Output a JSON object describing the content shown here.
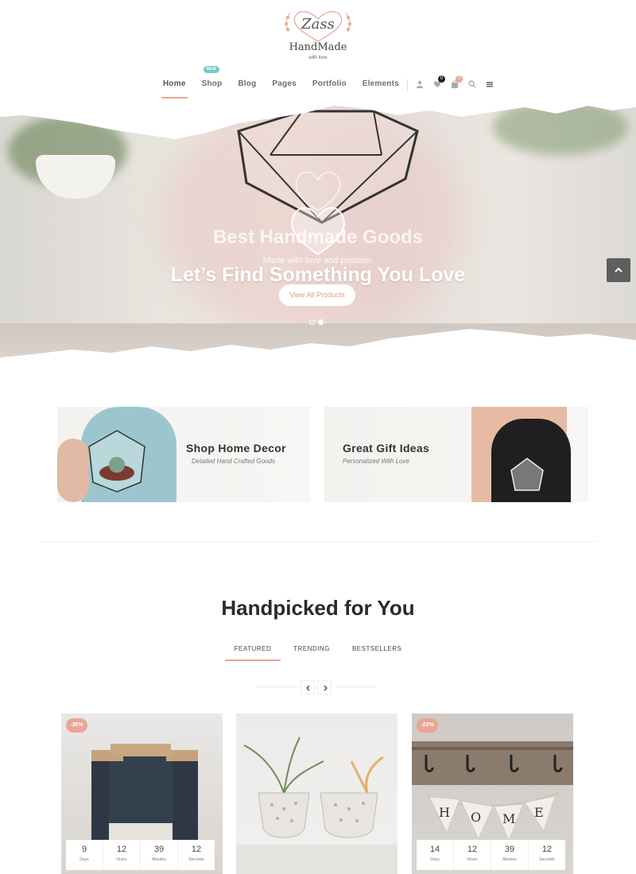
{
  "logo": {
    "brand": "Zass",
    "name": "HandMade",
    "tagline": "with love"
  },
  "nav": {
    "items": [
      {
        "label": "Home",
        "active": true
      },
      {
        "label": "Shop",
        "badge": "NEW"
      },
      {
        "label": "Blog"
      },
      {
        "label": "Pages"
      },
      {
        "label": "Portfolio"
      },
      {
        "label": "Elements"
      }
    ],
    "icons": [
      {
        "name": "user-icon"
      },
      {
        "name": "heart-icon",
        "count": "0"
      },
      {
        "name": "cart-icon",
        "count": "0"
      },
      {
        "name": "search-icon"
      },
      {
        "name": "menu-icon"
      }
    ]
  },
  "hero": {
    "subtitle": "Best Handmade Goods",
    "tagline": "Made with love and passion.",
    "title": "Let’s Find Something You Love",
    "button": "View All Products",
    "slides": 2,
    "active_slide": 1
  },
  "promos": [
    {
      "title": "Shop Home Decor",
      "subtitle": "Detailed Hand Crafted Goods"
    },
    {
      "title": "Great Gift Ideas",
      "subtitle": "Personalized With Love"
    }
  ],
  "section": {
    "title": "Handpicked for You",
    "tabs": [
      "FEATURED",
      "TRENDING",
      "BESTSELLERS"
    ],
    "active_tab": 0
  },
  "products": [
    {
      "sale": "-30%",
      "countdown": {
        "days": "9",
        "hours": "12",
        "minutes": "39",
        "seconds": "12"
      }
    },
    {
      "sale": "",
      "countdown": null
    },
    {
      "sale": "-22%",
      "countdown": {
        "days": "14",
        "hours": "12",
        "minutes": "39",
        "seconds": "12"
      }
    }
  ],
  "countdown_labels": {
    "days": "Days",
    "hours": "Hours",
    "minutes": "Minutes",
    "seconds": "Seconds"
  },
  "colors": {
    "accent": "#e9a594",
    "teal": "#7ac9c8",
    "dark": "#2a2a2a"
  }
}
